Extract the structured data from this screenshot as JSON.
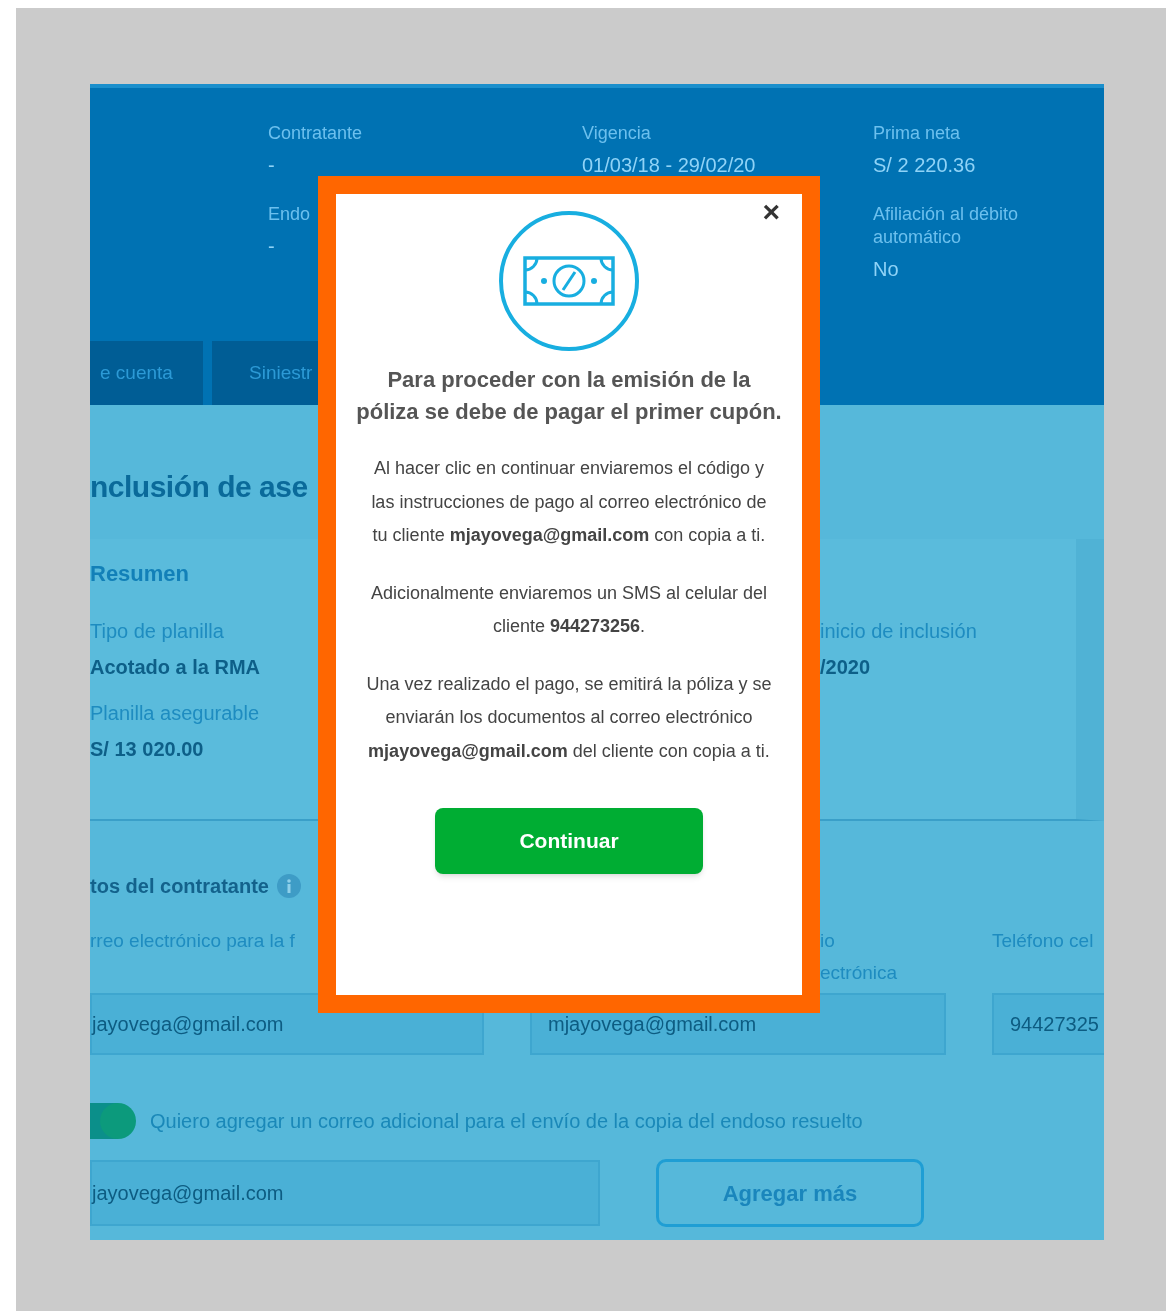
{
  "header": {
    "columns": [
      [
        {
          "label": "Contratante",
          "value": "-"
        },
        {
          "label": "Endo",
          "value": "-"
        }
      ],
      [
        {
          "label": "Vigencia",
          "value": "01/03/18 - 29/02/20"
        }
      ],
      [
        {
          "label": "Prima neta",
          "value": "S/ 2 220.36"
        },
        {
          "label": "Afiliación al débito automático",
          "value": "No"
        }
      ]
    ]
  },
  "tabs": [
    {
      "label": "e cuenta",
      "selected": false
    },
    {
      "label": "Siniestr",
      "selected": false
    }
  ],
  "page_title": "nclusión de ase",
  "summary": {
    "title": "Resumen",
    "left": [
      {
        "label": "Tipo de planilla",
        "value": "Acotado a la RMA"
      },
      {
        "label": "Planilla asegurable",
        "value": "S/ 13 020.00"
      }
    ],
    "right": [
      {
        "label": "inicio de inclusión",
        "value": "/2020"
      }
    ]
  },
  "contractor": {
    "title": "tos del contratante",
    "fields": [
      {
        "label_lines": [
          "rreo electrónico para la f"
        ],
        "value": "jayovega@gmail.com"
      },
      {
        "label_lines": [
          "io",
          "ectrónica"
        ],
        "value": "mjayovega@gmail.com"
      },
      {
        "label_lines": [
          "Teléfono cel"
        ],
        "value": "94427325"
      }
    ]
  },
  "additional": {
    "toggle_on": true,
    "label": "Quiero agregar un correo adicional para el envío de la copia del endoso resuelto",
    "email": "jayovega@gmail.com",
    "button": "Agregar más"
  },
  "modal": {
    "close": "×",
    "title": "Para proceder con la emisión de la póliza se debe de pagar el primer cupón.",
    "paragraphs": [
      "Al hacer clic en continuar enviaremos el código y las instrucciones de pago al correo electrónico de tu cliente **mjayovega@gmail.com** con copia a ti.",
      "Adicionalmente enviaremos un SMS al celular del cliente **944273256**.",
      "Una vez realizado el pago, se emitirá la póliza y se enviarán los documentos al correo electrónico **mjayovega@gmail.com** del cliente con copia a ti."
    ],
    "button": "Continuar"
  }
}
